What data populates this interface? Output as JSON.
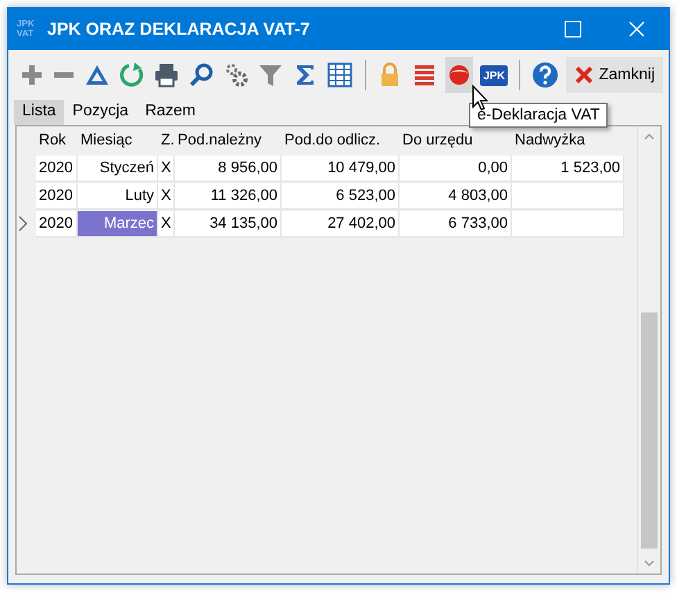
{
  "window": {
    "title": "JPK ORAZ DEKLARACJA VAT-7",
    "app_icon": [
      "JPK",
      "VAT"
    ]
  },
  "toolbar": [
    {
      "kind": "plus"
    },
    {
      "kind": "minus"
    },
    {
      "kind": "delta"
    },
    {
      "kind": "refresh"
    },
    {
      "kind": "print"
    },
    {
      "kind": "search"
    },
    {
      "kind": "gears"
    },
    {
      "kind": "filter"
    },
    {
      "kind": "sigma"
    },
    {
      "kind": "columns"
    },
    {
      "kind": "separator"
    },
    {
      "kind": "lock"
    },
    {
      "kind": "list"
    },
    {
      "kind": "edecl",
      "hovered": true
    },
    {
      "kind": "badge",
      "label": "JPK"
    },
    {
      "kind": "separator"
    },
    {
      "kind": "help"
    },
    {
      "kind": "close",
      "label": "Zamknij"
    }
  ],
  "tooltip": "e-Deklaracja VAT",
  "tabs": [
    {
      "label": "Lista",
      "selected": true
    },
    {
      "label": "Pozycja",
      "selected": false
    },
    {
      "label": "Razem",
      "selected": false
    }
  ],
  "table": {
    "columns": [
      "Rok",
      "Miesiąc",
      "Z.",
      "Pod.należny",
      "Pod.do odlicz.",
      "Do urzędu",
      "Nadwyżka"
    ],
    "rows": [
      {
        "current": false,
        "cells": [
          "2020",
          "Styczeń",
          "X",
          "8 956,00",
          "10 479,00",
          "0,00",
          "1 523,00"
        ]
      },
      {
        "current": false,
        "cells": [
          "2020",
          "Luty",
          "X",
          "11 326,00",
          "6 523,00",
          "4 803,00",
          ""
        ]
      },
      {
        "current": true,
        "cells": [
          "2020",
          "Marzec",
          "X",
          "34 135,00",
          "27 402,00",
          "6 733,00",
          ""
        ]
      }
    ]
  }
}
